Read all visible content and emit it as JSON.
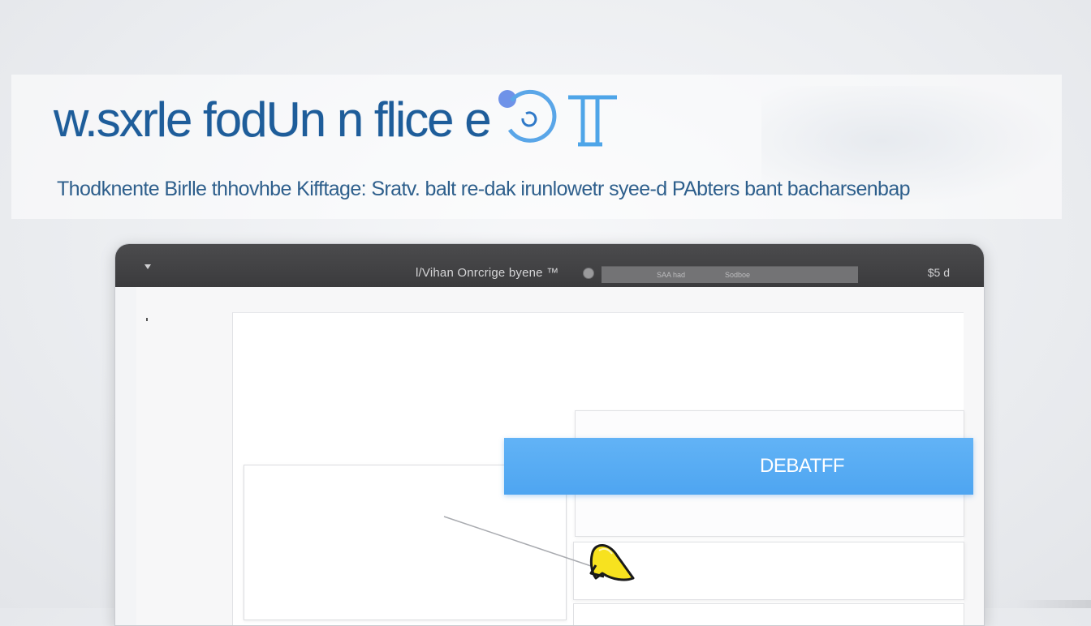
{
  "hero": {
    "headline": "w.sxrle fodUn n flice e",
    "subheadline": "Thodknente  Birlle thhovhbe Kifftage: Sratv. balt  re-dak  irunlowetr syee-d PAbters  bant bacharsenbap"
  },
  "window": {
    "title": "l/Vihan Onrcrige byene ™",
    "address_text_a": "SAA had",
    "address_text_b": "Sodboe",
    "status_text": "$5 d"
  },
  "main": {
    "action_button_label": "DEBATFF"
  },
  "colors": {
    "accent_blue": "#4ea5f1",
    "headline_blue": "#1e5d9a",
    "titlebar": "#3b3b3d",
    "cursor_yellow": "#f7e21f"
  },
  "icons": {
    "logo": "logo-mark-icon",
    "menu": "menu-icon",
    "cursor": "pointer-cursor-icon"
  }
}
